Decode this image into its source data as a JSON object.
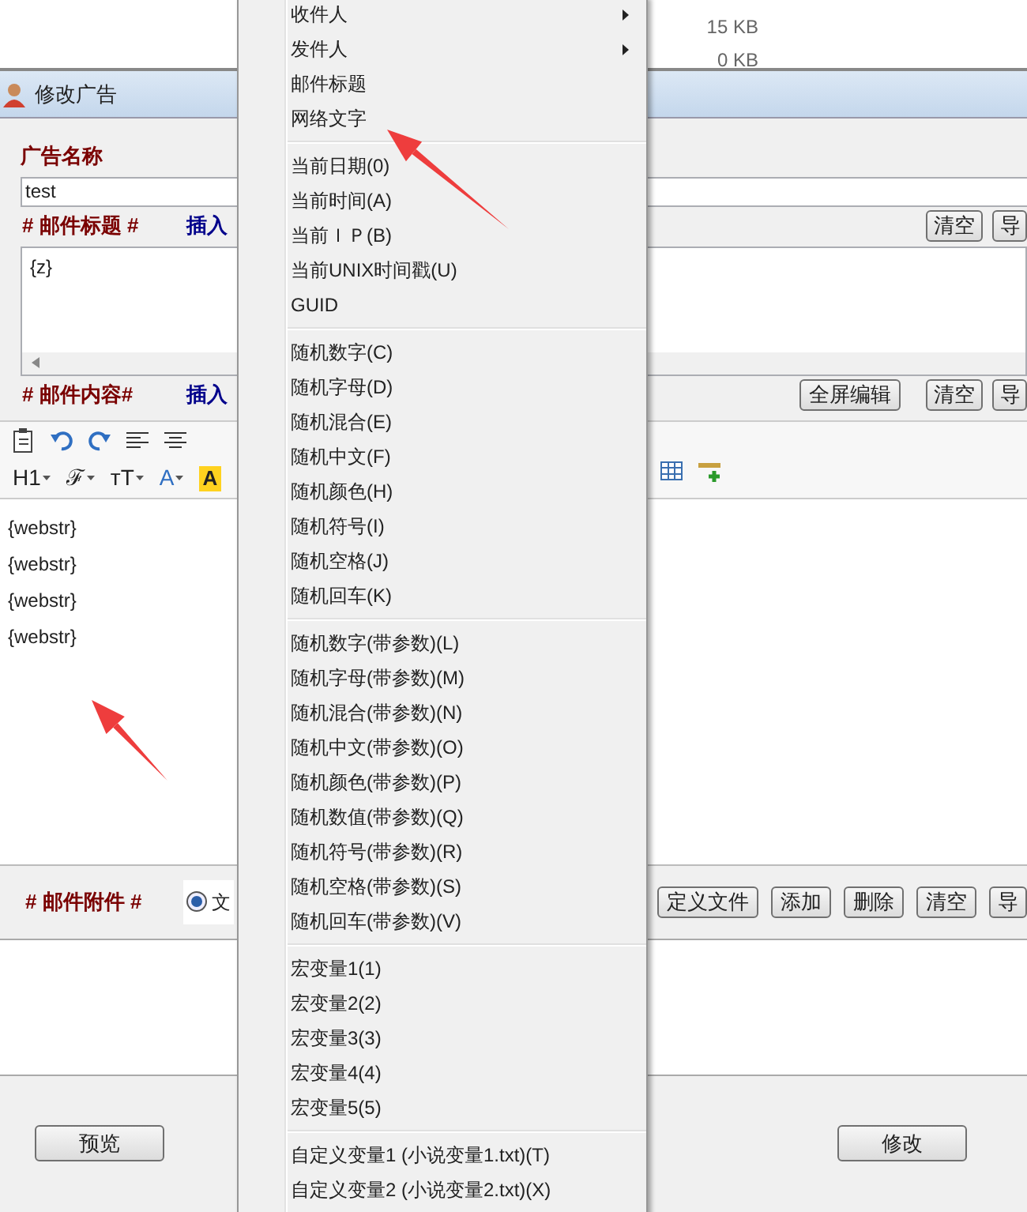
{
  "background_list": {
    "sizes": [
      "15 KB",
      "0 KB"
    ]
  },
  "dialog": {
    "title": "修改广告",
    "ad_name": {
      "label": "广告名称",
      "value": "test"
    },
    "subject": {
      "label": "# 邮件标题 #",
      "insert_link": "插入",
      "buttons": [
        "清空",
        "导"
      ],
      "value": "{z}"
    },
    "content": {
      "label": "# 邮件内容#",
      "insert_link": "插入",
      "buttons": [
        "全屏编辑",
        "清空",
        "导"
      ],
      "format_tools": [
        {
          "label": "H1",
          "kind": "dropdown"
        },
        {
          "label": "ℱ",
          "kind": "dropdown"
        },
        {
          "label": "ᴛT",
          "kind": "dropdown"
        },
        {
          "label": "A",
          "kind": "color"
        },
        {
          "label": "A",
          "kind": "highlight"
        }
      ],
      "lines": [
        "{webstr}",
        "{webstr}",
        "{webstr}",
        "{webstr}"
      ]
    },
    "attachments": {
      "label": "# 邮件附件 #",
      "radio": {
        "label": "文",
        "selected": true
      },
      "buttons": [
        "定义文件",
        "添加",
        "删除",
        "清空",
        "导"
      ]
    },
    "footer_buttons": [
      "预览",
      "修改"
    ]
  },
  "context_menu": {
    "groups": [
      [
        {
          "label": "收件人",
          "submenu": true
        },
        {
          "label": "发件人",
          "submenu": true
        },
        {
          "label": "邮件标题",
          "submenu": false
        },
        {
          "label": "网络文字",
          "submenu": false
        }
      ],
      [
        {
          "label": "当前日期(0)",
          "submenu": false
        },
        {
          "label": "当前时间(A)",
          "submenu": false
        },
        {
          "label": "当前ＩＰ(B)",
          "submenu": false
        },
        {
          "label": "当前UNIX时间戳(U)",
          "submenu": false
        },
        {
          "label": "GUID",
          "submenu": false
        }
      ],
      [
        {
          "label": "随机数字(C)",
          "submenu": false
        },
        {
          "label": "随机字母(D)",
          "submenu": false
        },
        {
          "label": "随机混合(E)",
          "submenu": false
        },
        {
          "label": "随机中文(F)",
          "submenu": false
        },
        {
          "label": "随机颜色(H)",
          "submenu": false
        },
        {
          "label": "随机符号(I)",
          "submenu": false
        },
        {
          "label": "随机空格(J)",
          "submenu": false
        },
        {
          "label": "随机回车(K)",
          "submenu": false
        }
      ],
      [
        {
          "label": "随机数字(带参数)(L)",
          "submenu": false
        },
        {
          "label": "随机字母(带参数)(M)",
          "submenu": false
        },
        {
          "label": "随机混合(带参数)(N)",
          "submenu": false
        },
        {
          "label": "随机中文(带参数)(O)",
          "submenu": false
        },
        {
          "label": "随机颜色(带参数)(P)",
          "submenu": false
        },
        {
          "label": "随机数值(带参数)(Q)",
          "submenu": false
        },
        {
          "label": "随机符号(带参数)(R)",
          "submenu": false
        },
        {
          "label": "随机空格(带参数)(S)",
          "submenu": false
        },
        {
          "label": "随机回车(带参数)(V)",
          "submenu": false
        }
      ],
      [
        {
          "label": "宏变量1(1)",
          "submenu": false
        },
        {
          "label": "宏变量2(2)",
          "submenu": false
        },
        {
          "label": "宏变量3(3)",
          "submenu": false
        },
        {
          "label": "宏变量4(4)",
          "submenu": false
        },
        {
          "label": "宏变量5(5)",
          "submenu": false
        }
      ],
      [
        {
          "label": "自定义变量1 (小说变量1.txt)(T)",
          "submenu": false
        },
        {
          "label": "自定义变量2 (小说变量2.txt)(X)",
          "submenu": false
        }
      ]
    ]
  }
}
